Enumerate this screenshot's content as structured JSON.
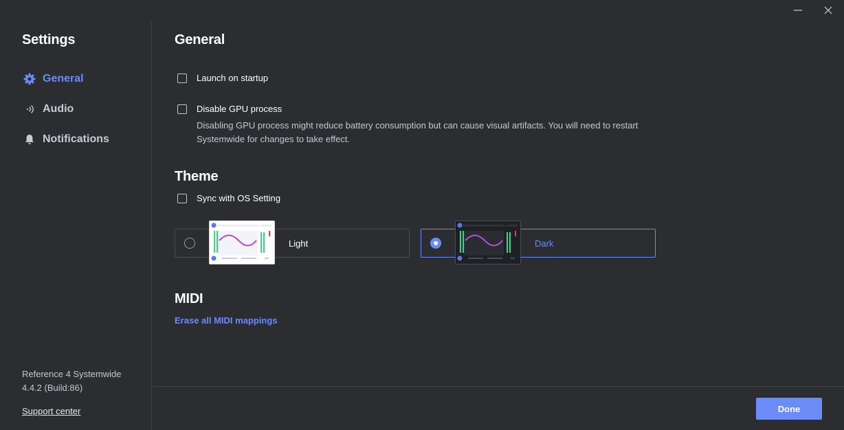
{
  "window": {
    "minimize_icon": "minimize-icon",
    "close_icon": "close-icon"
  },
  "sidebar": {
    "title": "Settings",
    "items": [
      {
        "label": "General",
        "icon": "gear-icon",
        "active": true
      },
      {
        "label": "Audio",
        "icon": "audio-signal-icon",
        "active": false
      },
      {
        "label": "Notifications",
        "icon": "bell-icon",
        "active": false
      }
    ],
    "version_line1": "Reference 4 Systemwide",
    "version_line2": "4.4.2 (Build:86)",
    "support_link": "Support center"
  },
  "general": {
    "heading": "General",
    "launch_startup": {
      "label": "Launch on startup",
      "checked": false
    },
    "disable_gpu": {
      "label": "Disable GPU process",
      "checked": false,
      "description": "Disabling GPU process might reduce battery consumption but can cause visual artifacts. You will need to restart Systemwide for changes to take effect."
    }
  },
  "theme": {
    "heading": "Theme",
    "sync_os": {
      "label": "Sync with OS Setting",
      "checked": false
    },
    "options": [
      {
        "label": "Light",
        "selected": false
      },
      {
        "label": "Dark",
        "selected": true
      }
    ]
  },
  "midi": {
    "heading": "MIDI",
    "erase_link": "Erase all MIDI mappings"
  },
  "footer": {
    "done_label": "Done"
  },
  "colors": {
    "accent": "#6b8cf7",
    "background": "#2b2d31",
    "wave": "#b14fd6",
    "meter_green": "#3fd28a",
    "meter_red": "#e0453a"
  }
}
